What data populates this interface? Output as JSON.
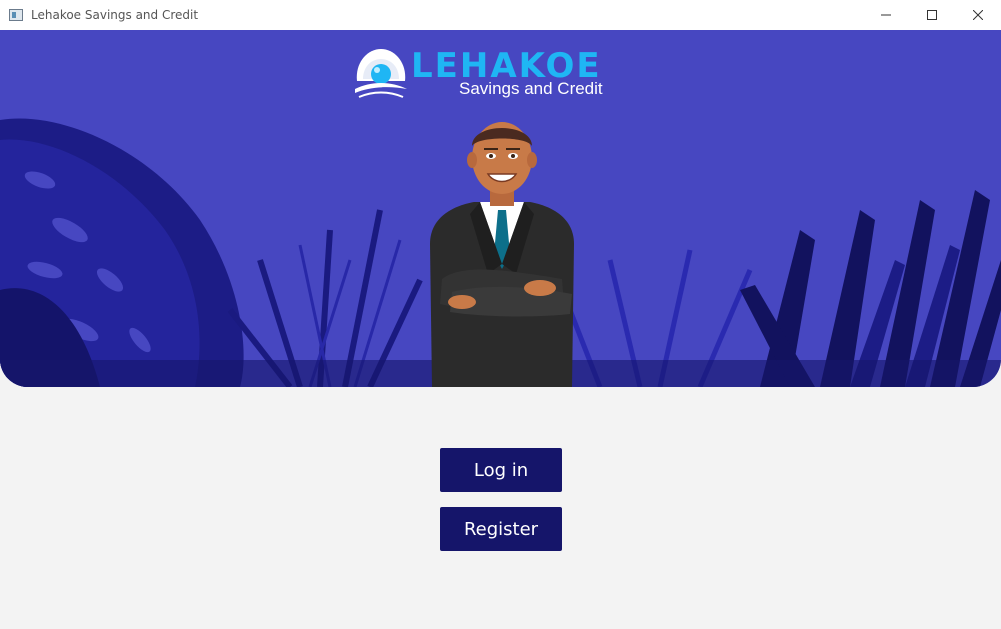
{
  "window": {
    "title": "Lehakoe Savings and Credit",
    "controls": [
      "minimize-icon",
      "maximize-icon",
      "close-icon"
    ]
  },
  "hero": {
    "logo_word": "LEHAKOE",
    "logo_subtitle": "Savings and Credit",
    "colors": {
      "banner": "#4747c1",
      "logo_accent": "#1fb6f4",
      "leaves_dark": "#16166b",
      "leaves_mid": "#2a2ab0"
    }
  },
  "actions": {
    "login_label": "Log in",
    "register_label": "Register",
    "button_color": "#15156a"
  }
}
